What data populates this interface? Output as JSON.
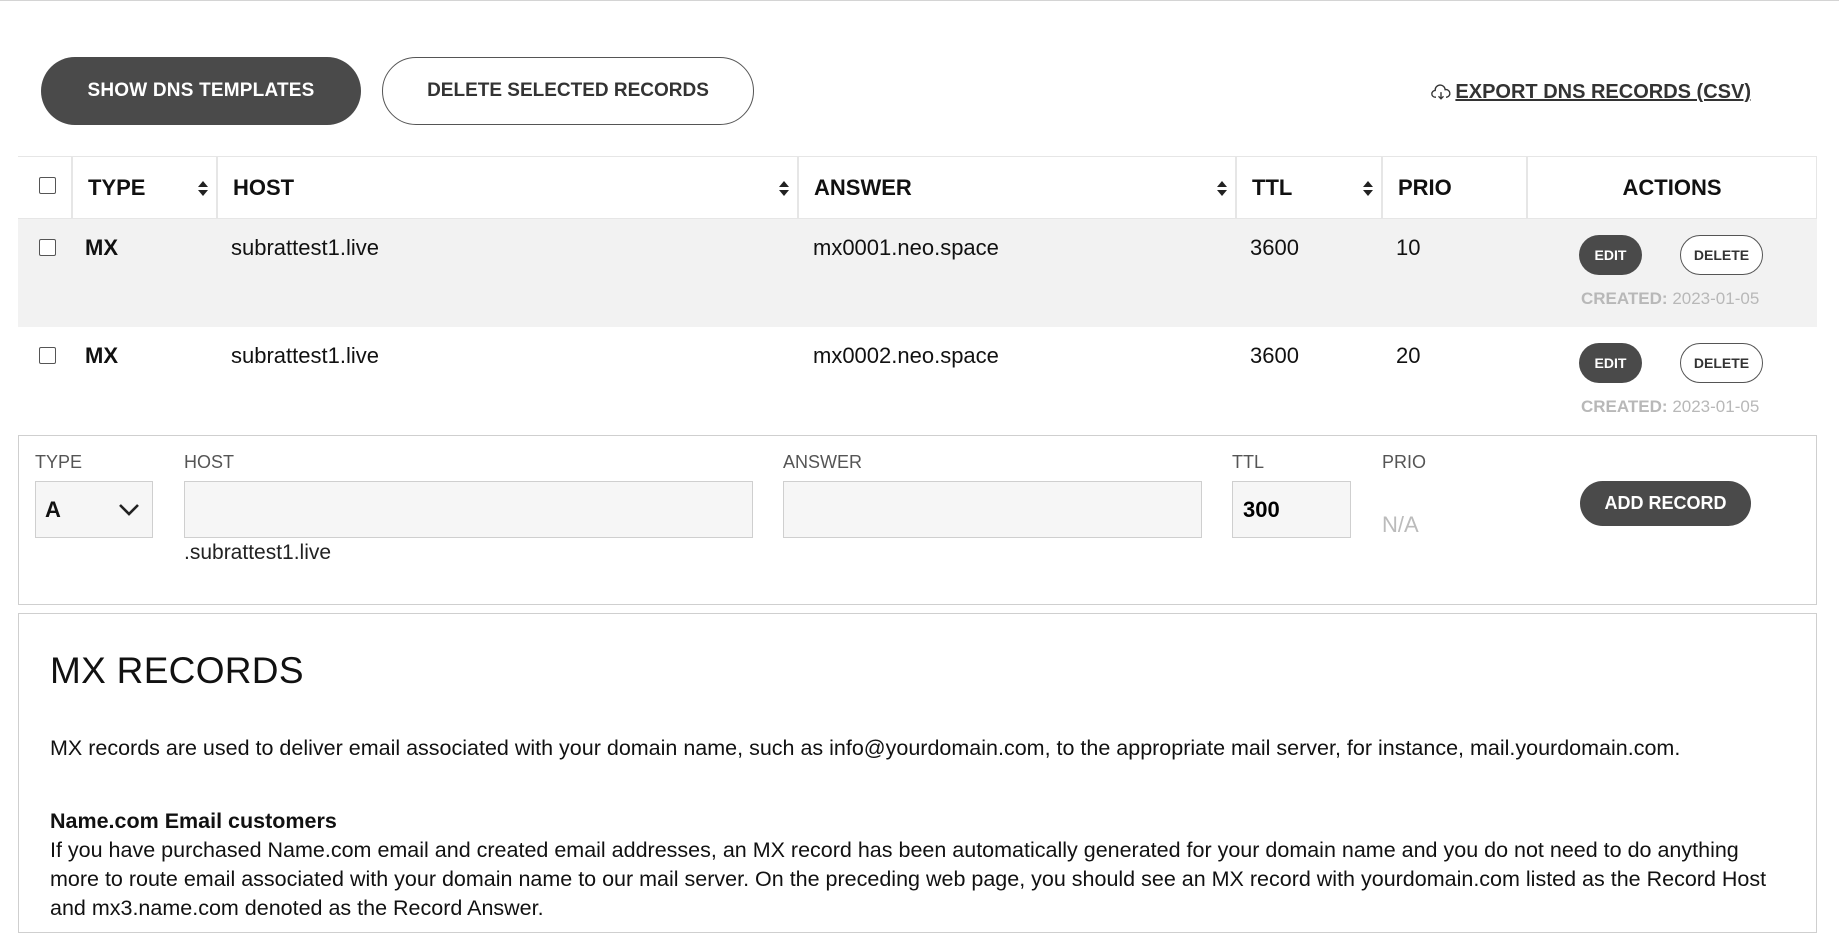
{
  "toolbar": {
    "show_templates_label": "SHOW DNS TEMPLATES",
    "delete_selected_label": "DELETE SELECTED RECORDS",
    "export_label": " EXPORT DNS RECORDS (CSV)"
  },
  "table": {
    "headers": [
      "TYPE",
      "HOST",
      "ANSWER",
      "TTL",
      "PRIO",
      "ACTIONS"
    ],
    "rows": [
      {
        "type": "MX",
        "host": "subrattest1.live",
        "answer": "mx0001.neo.space",
        "ttl": "3600",
        "prio": "10",
        "edit": "EDIT",
        "delete": "DELETE",
        "created_label": "CREATED:",
        "created_date": "2023-01-05"
      },
      {
        "type": "MX",
        "host": "subrattest1.live",
        "answer": "mx0002.neo.space",
        "ttl": "3600",
        "prio": "20",
        "edit": "EDIT",
        "delete": "DELETE",
        "created_label": "CREATED:",
        "created_date": "2023-01-05"
      }
    ]
  },
  "add_form": {
    "type_label": "TYPE",
    "type_value": "A",
    "host_label": "HOST",
    "host_value": "",
    "host_suffix": ".subrattest1.live",
    "answer_label": "ANSWER",
    "answer_value": "",
    "ttl_label": "TTL",
    "ttl_value": "300",
    "prio_label": "PRIO",
    "prio_value": "N/A",
    "add_label": "ADD RECORD"
  },
  "info": {
    "title": "MX RECORDS",
    "p1": "MX records are used to deliver email associated with your domain name, such as info@yourdomain.com, to the appropriate mail server, for instance, mail.yourdomain.com.",
    "subheading": "Name.com Email customers",
    "p2": "If you have purchased Name.com email and created email addresses, an MX record has been automatically generated for your domain name and you do not need to do anything more to route email associated with your domain name to our mail server. On the preceding web page, you should see an MX record with yourdomain.com listed as the Record Host and mx3.name.com denoted as the Record Answer."
  },
  "icons": {
    "export": "cloud-download-icon",
    "sort": "sort-arrows-icon",
    "select_chevron": "chevron-down-icon"
  },
  "colors": {
    "button_dark": "#4a4a4a",
    "row_alt": "#f2f2f2",
    "muted_text": "#b8b8b8"
  }
}
